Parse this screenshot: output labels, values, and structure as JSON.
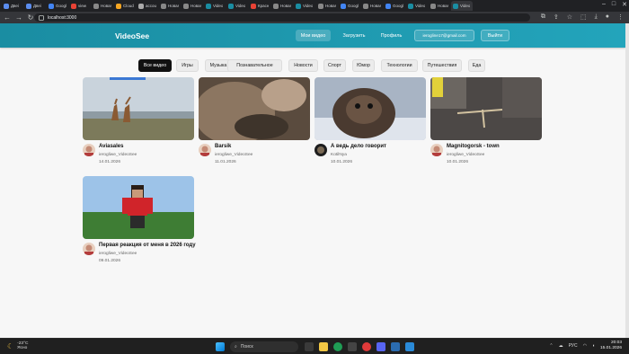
{
  "browser": {
    "tabs": [
      {
        "label": "Двеі",
        "fav": "#5b8def"
      },
      {
        "label": "Двеі",
        "fav": "#5b8def"
      },
      {
        "label": "Google",
        "fav": "#4285f4"
      },
      {
        "label": "view",
        "fav": "#e94235"
      },
      {
        "label": "Новая",
        "fav": "#888888"
      },
      {
        "label": "Cloud",
        "fav": "#f6a623"
      },
      {
        "label": "accou",
        "fav": "#aaaaaa"
      },
      {
        "label": "Новая",
        "fav": "#888888"
      },
      {
        "label": "Новая",
        "fav": "#888888"
      },
      {
        "label": "Video",
        "fav": "#1a8da2"
      },
      {
        "label": "Video",
        "fav": "#1a8da2"
      },
      {
        "label": "Красн",
        "fav": "#e94235"
      },
      {
        "label": "Новая",
        "fav": "#888888"
      },
      {
        "label": "Video",
        "fav": "#1a8da2"
      },
      {
        "label": "Новая",
        "fav": "#888888"
      },
      {
        "label": "Google",
        "fav": "#4285f4"
      },
      {
        "label": "Новая",
        "fav": "#888888"
      },
      {
        "label": "Google",
        "fav": "#4285f4"
      },
      {
        "label": "Video",
        "fav": "#1a8da2"
      },
      {
        "label": "Новая",
        "fav": "#888888"
      },
      {
        "label": "Video",
        "fav": "#1a8da2",
        "active": true
      }
    ],
    "url": "localhost:3000"
  },
  "header": {
    "logo": "VideoSee",
    "nav": {
      "my_videos": "Мои видео",
      "upload": "Загрузить",
      "profile": "Профиль",
      "email": "ierogline17@gmail.com",
      "logout": "Выйти"
    }
  },
  "categories": [
    {
      "label": "Все видео",
      "selected": true
    },
    {
      "label": "Игры"
    },
    {
      "label": "Музыка"
    },
    {
      "label": "Познавательное"
    },
    {
      "label": "Новости"
    },
    {
      "label": "Спорт"
    },
    {
      "label": "Юмор"
    },
    {
      "label": "Технологии"
    },
    {
      "label": "Путешествия"
    },
    {
      "label": "Еда"
    }
  ],
  "videos": [
    {
      "title": "Aviasales",
      "author": "ierogliwe_VideoSee",
      "date": "14.01.2026"
    },
    {
      "title": "Barsik",
      "author": "ierogliwe_VideoSee",
      "date": "11.01.2026"
    },
    {
      "title": "А ведь дело говорит",
      "author": "KotilNya",
      "date": "10.01.2026"
    },
    {
      "title": "Magnitogorsk - town",
      "author": "ierogliwe_VideoSee",
      "date": "10.01.2026"
    },
    {
      "title": "Первая реакция от меня в 2026 году",
      "author": "ierogliwe_VideoSee",
      "date": "09.01.2026"
    }
  ],
  "taskbar": {
    "weather_temp": "-23°C",
    "weather_desc": "Ясно",
    "search": "Поиск",
    "lang": "РУС",
    "time": "20:03",
    "date": "15.01.2026"
  }
}
